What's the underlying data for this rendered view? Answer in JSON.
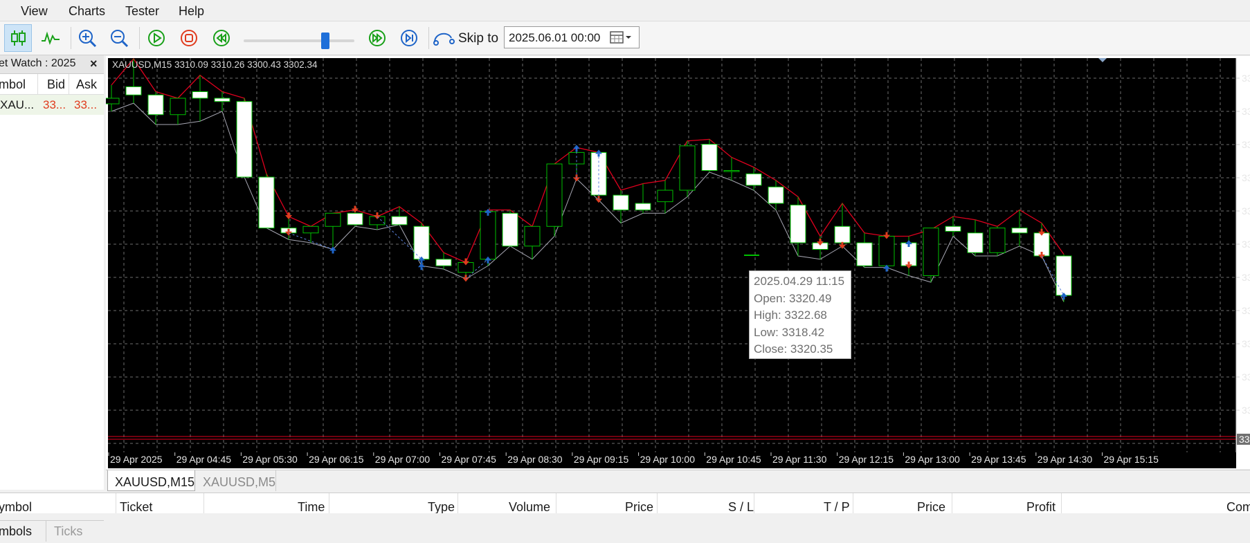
{
  "menu": [
    "View",
    "Charts",
    "Tester",
    "Help"
  ],
  "toolbar": {
    "skip_to_label": "Skip to",
    "skip_to_value": "2025.06.01 00:00",
    "speed_fraction": 0.7
  },
  "market_watch": {
    "title": "ket Watch : 2025",
    "close": "×",
    "columns": [
      "mbol",
      "Bid",
      "Ask"
    ],
    "row": {
      "symbol": "XAU...",
      "bid": "33...",
      "ask": "33..."
    },
    "tabs": [
      "mbols",
      "Ticks"
    ]
  },
  "chart": {
    "info": "XAUUSD,M15  3310.09 3310.26 3300.43 3302.34",
    "x_labels": [
      "29 Apr 2025",
      "29 Apr 04:45",
      "29 Apr 05:30",
      "29 Apr 06:15",
      "29 Apr 07:00",
      "29 Apr 07:45",
      "29 Apr 08:30",
      "29 Apr 09:15",
      "29 Apr 10:00",
      "29 Apr 10:45",
      "29 Apr 11:30",
      "29 Apr 12:15",
      "29 Apr 13:00",
      "29 Apr 13:45",
      "29 Apr 14:30",
      "29 Apr 15:15"
    ],
    "y_label_stub": "33",
    "price_tag": "33",
    "colors": {
      "bg": "#000000",
      "grid": "#6e6e6e",
      "up": "#00c000",
      "upper_env": "#e0001e",
      "lower_env": "#a8a8b4",
      "buy": "#1e64c8",
      "sell": "#e03c1e"
    }
  },
  "chart_data": {
    "type": "candlestick",
    "symbol": "XAUUSD",
    "timeframe": "M15",
    "candles": [
      {
        "o": 3322.3,
        "h": 3328.0,
        "l": 3320.0,
        "c": 3324.0
      },
      {
        "o": 3327.5,
        "h": 3336.0,
        "l": 3322.5,
        "c": 3325.0
      },
      {
        "o": 3325.0,
        "h": 3326.0,
        "l": 3316.0,
        "c": 3319.0
      },
      {
        "o": 3319.0,
        "h": 3324.0,
        "l": 3316.0,
        "c": 3324.0
      },
      {
        "o": 3326.0,
        "h": 3331.0,
        "l": 3317.0,
        "c": 3324.0
      },
      {
        "o": 3324.0,
        "h": 3326.0,
        "l": 3320.0,
        "c": 3323.0
      },
      {
        "o": 3323.0,
        "h": 3324.0,
        "l": 3300.0,
        "c": 3300.0
      },
      {
        "o": 3300.0,
        "h": 3301.0,
        "l": 3284.5,
        "c": 3284.5
      },
      {
        "o": 3284.5,
        "h": 3288.0,
        "l": 3281.0,
        "c": 3283.0
      },
      {
        "o": 3283.0,
        "h": 3285.0,
        "l": 3280.0,
        "c": 3285.0
      },
      {
        "o": 3285.0,
        "h": 3289.0,
        "l": 3278.0,
        "c": 3289.0
      },
      {
        "o": 3289.0,
        "h": 3290.0,
        "l": 3285.0,
        "c": 3285.5
      },
      {
        "o": 3285.5,
        "h": 3288.0,
        "l": 3284.0,
        "c": 3288.0
      },
      {
        "o": 3288.0,
        "h": 3291.0,
        "l": 3285.5,
        "c": 3285.5
      },
      {
        "o": 3285.0,
        "h": 3286.0,
        "l": 3273.0,
        "c": 3275.0
      },
      {
        "o": 3275.0,
        "h": 3277.0,
        "l": 3272.0,
        "c": 3273.0
      },
      {
        "o": 3271.0,
        "h": 3274.0,
        "l": 3269.0,
        "c": 3274.0
      },
      {
        "o": 3275.0,
        "h": 3290.0,
        "l": 3273.0,
        "c": 3289.5
      },
      {
        "o": 3289.0,
        "h": 3290.0,
        "l": 3279.0,
        "c": 3279.0
      },
      {
        "o": 3279.0,
        "h": 3285.0,
        "l": 3275.0,
        "c": 3285.0
      },
      {
        "o": 3285.0,
        "h": 3304.0,
        "l": 3282.0,
        "c": 3304.0
      },
      {
        "o": 3304.0,
        "h": 3309.0,
        "l": 3299.5,
        "c": 3307.5
      },
      {
        "o": 3307.5,
        "h": 3307.5,
        "l": 3293.0,
        "c": 3294.5
      },
      {
        "o": 3294.5,
        "h": 3296.0,
        "l": 3286.0,
        "c": 3290.0
      },
      {
        "o": 3292.0,
        "h": 3298.0,
        "l": 3289.0,
        "c": 3290.0
      },
      {
        "o": 3292.5,
        "h": 3299.0,
        "l": 3289.0,
        "c": 3296.0
      },
      {
        "o": 3296.0,
        "h": 3311.0,
        "l": 3294.0,
        "c": 3309.5
      },
      {
        "o": 3310.0,
        "h": 3311.5,
        "l": 3301.5,
        "c": 3302.0
      },
      {
        "o": 3302.0,
        "h": 3306.0,
        "l": 3299.0,
        "c": 3302.0
      },
      {
        "o": 3301.0,
        "h": 3303.0,
        "l": 3296.0,
        "c": 3297.5
      },
      {
        "o": 3297.0,
        "h": 3299.0,
        "l": 3290.0,
        "c": 3292.0
      },
      {
        "o": 3291.5,
        "h": 3294.0,
        "l": 3276.0,
        "c": 3280.0
      },
      {
        "o": 3280.0,
        "h": 3282.0,
        "l": 3275.0,
        "c": 3278.0
      },
      {
        "o": 3285.0,
        "h": 3292.0,
        "l": 3279.0,
        "c": 3280.0
      },
      {
        "o": 3280.0,
        "h": 3283.0,
        "l": 3272.5,
        "c": 3273.0
      },
      {
        "o": 3273.0,
        "h": 3282.0,
        "l": 3272.5,
        "c": 3282.0
      },
      {
        "o": 3280.0,
        "h": 3282.0,
        "l": 3270.0,
        "c": 3273.0
      },
      {
        "o": 3270.0,
        "h": 3284.0,
        "l": 3268.0,
        "c": 3284.5
      },
      {
        "o": 3285.0,
        "h": 3288.0,
        "l": 3282.0,
        "c": 3283.5
      },
      {
        "o": 3283.0,
        "h": 3287.0,
        "l": 3276.0,
        "c": 3277.0
      },
      {
        "o": 3277.0,
        "h": 3285.0,
        "l": 3276.0,
        "c": 3284.5
      },
      {
        "o": 3284.5,
        "h": 3290.0,
        "l": 3279.0,
        "c": 3283.0
      },
      {
        "o": 3283.0,
        "h": 3286.0,
        "l": 3276.0,
        "c": 3276.0
      },
      {
        "o": 3276.0,
        "h": 3276.5,
        "l": 3262.0,
        "c": 3264.0
      }
    ],
    "tooltip": {
      "time": "2025.04.29 11:15",
      "open": "Open: 3320.49",
      "high": "High: 3322.68",
      "low": "Low: 3318.42",
      "close": "Close: 3320.35"
    }
  },
  "chart_tabs": [
    "XAUUSD,M15",
    "XAUUSD,M5"
  ],
  "trade_columns": [
    "ymbol",
    "Ticket",
    "Time",
    "Type",
    "Volume",
    "Price",
    "S / L",
    "T / P",
    "Price",
    "Profit",
    "Com"
  ]
}
